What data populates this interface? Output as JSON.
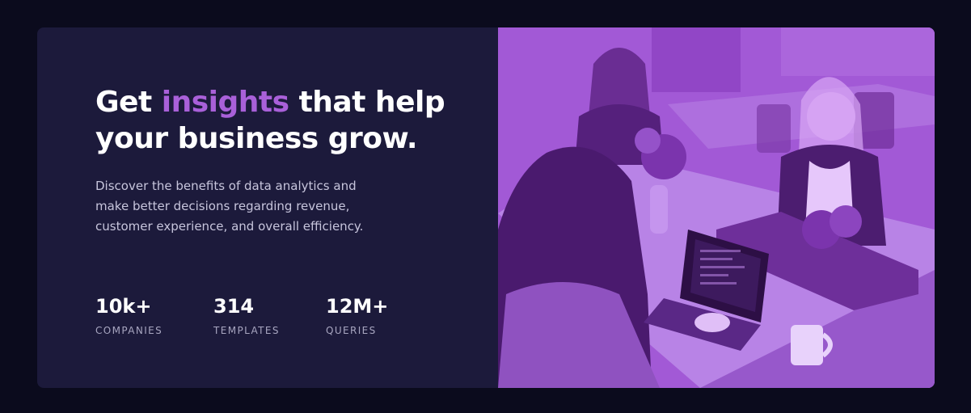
{
  "headline": {
    "prefix": "Get",
    "accent": "insights",
    "suffix_line1": "that help",
    "line2": "your business grow."
  },
  "description": "Discover the benefits of data analytics and make better decisions regarding revenue, customer experience, and overall efficiency.",
  "stats": [
    {
      "value": "10k+",
      "label": "COMPANIES"
    },
    {
      "value": "314",
      "label": "TEMPLATES"
    },
    {
      "value": "12M+",
      "label": "QUERIES"
    }
  ],
  "colors": {
    "page_background": "#0b0b1d",
    "card_background": "#1c1a3b",
    "accent": "#a960d9",
    "image_overlay": "#a259d6"
  },
  "image": {
    "subject": "office-team-photo"
  }
}
